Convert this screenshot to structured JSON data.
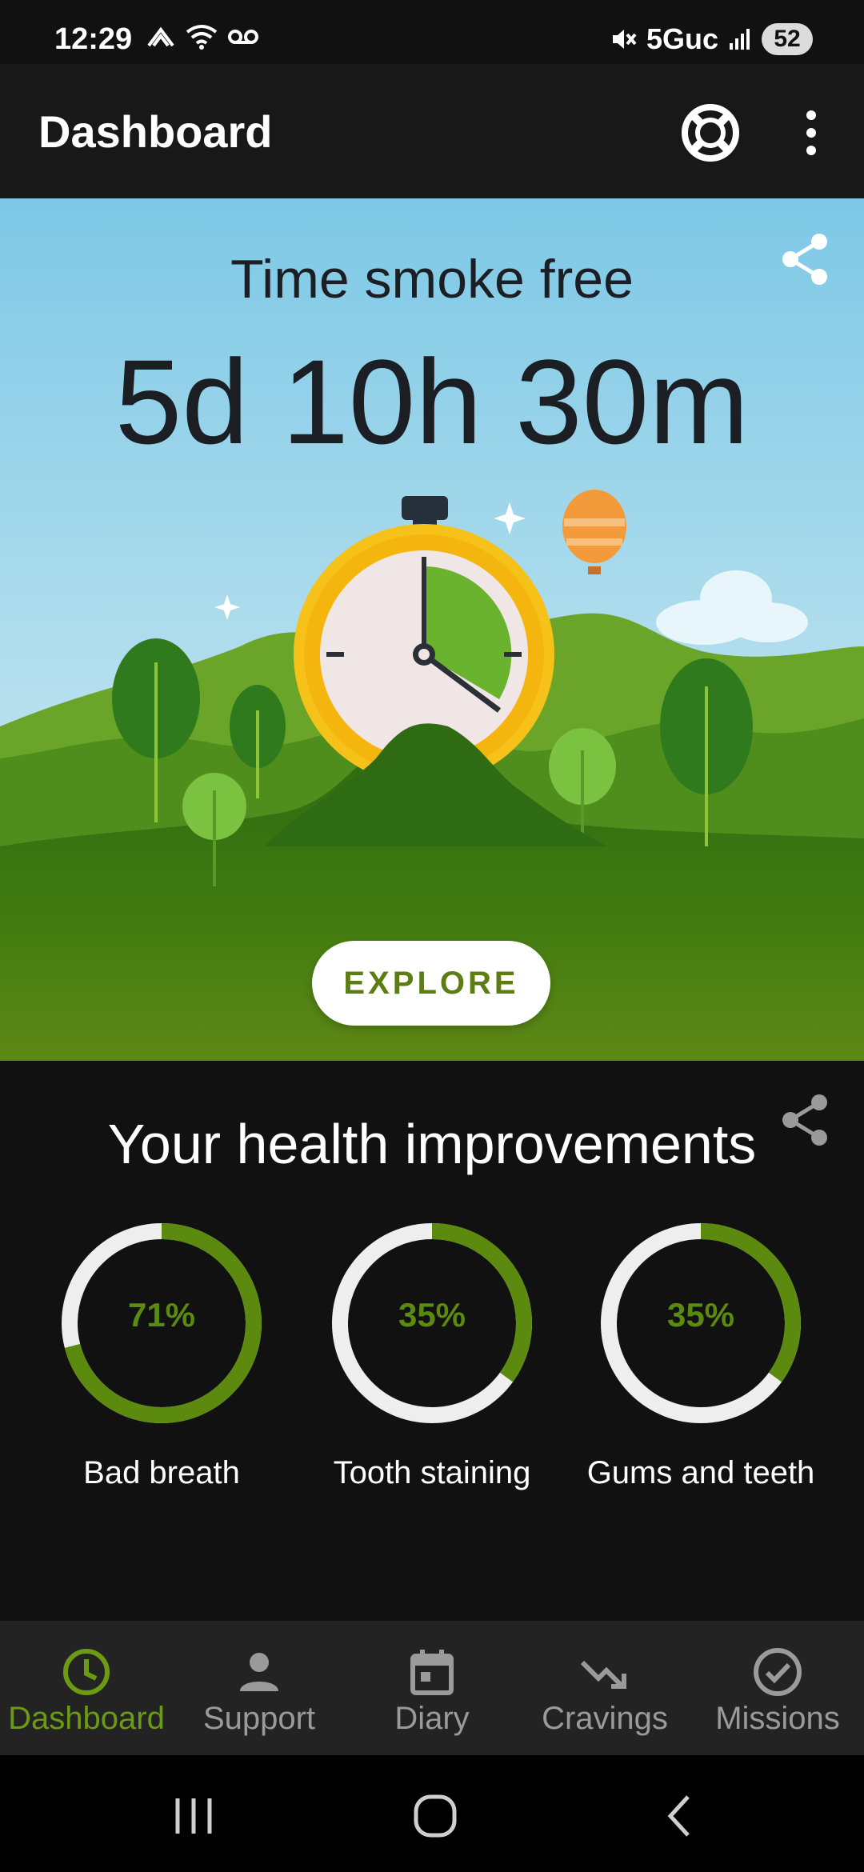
{
  "status_bar": {
    "time": "12:29",
    "network": "5Guc",
    "battery": "52"
  },
  "app_bar": {
    "title": "Dashboard"
  },
  "hero": {
    "title": "Time smoke free",
    "time_value": "5d 10h 30m",
    "explore_label": "EXPLORE"
  },
  "health": {
    "title": "Your health improvements",
    "items": [
      {
        "label": "Bad breath",
        "percent_label": "71%",
        "progress": 0.71
      },
      {
        "label": "Tooth staining",
        "percent_label": "35%",
        "progress": 0.35
      },
      {
        "label": "Gums and teeth",
        "percent_label": "35%",
        "progress": 0.35
      }
    ]
  },
  "bottom_nav": {
    "items": [
      {
        "label": "Dashboard",
        "icon": "clock-icon",
        "active": true
      },
      {
        "label": "Support",
        "icon": "person-icon",
        "active": false
      },
      {
        "label": "Diary",
        "icon": "calendar-icon",
        "active": false
      },
      {
        "label": "Cravings",
        "icon": "trend-down-icon",
        "active": false
      },
      {
        "label": "Missions",
        "icon": "check-circle-icon",
        "active": false
      }
    ]
  },
  "colors": {
    "accent_green": "#5b8a0e",
    "active_nav": "#6b9a14",
    "ring_track": "#eeeeee"
  }
}
